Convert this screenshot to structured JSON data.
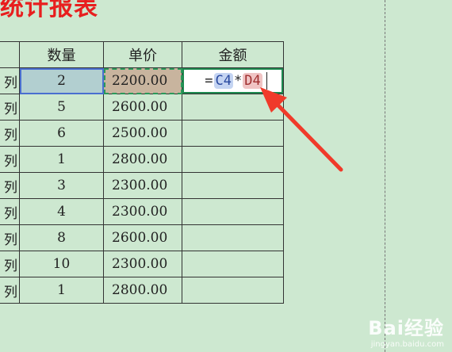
{
  "sheet": {
    "title": "统计报表",
    "headers": [
      "",
      "数量",
      "单价",
      "金额"
    ],
    "rows": [
      {
        "label": "列",
        "qty": "2",
        "price": "2200.00"
      },
      {
        "label": "列",
        "qty": "5",
        "price": "2600.00"
      },
      {
        "label": "列",
        "qty": "6",
        "price": "2500.00"
      },
      {
        "label": "列",
        "qty": "1",
        "price": "2800.00"
      },
      {
        "label": "列",
        "qty": "3",
        "price": "2300.00"
      },
      {
        "label": "列",
        "qty": "4",
        "price": "2300.00"
      },
      {
        "label": "列",
        "qty": "8",
        "price": "2600.00"
      },
      {
        "label": "列",
        "qty": "10",
        "price": "2300.00"
      },
      {
        "label": "列",
        "qty": "1",
        "price": "2800.00"
      }
    ],
    "formula": {
      "eq": "=",
      "ref1": "C4",
      "op": "*",
      "ref2": "D4"
    }
  },
  "annotation": {
    "arrow_color": "#f03a2a"
  },
  "watermark": {
    "brand": "Bai经验",
    "url": "jingyan.baidu.com"
  }
}
